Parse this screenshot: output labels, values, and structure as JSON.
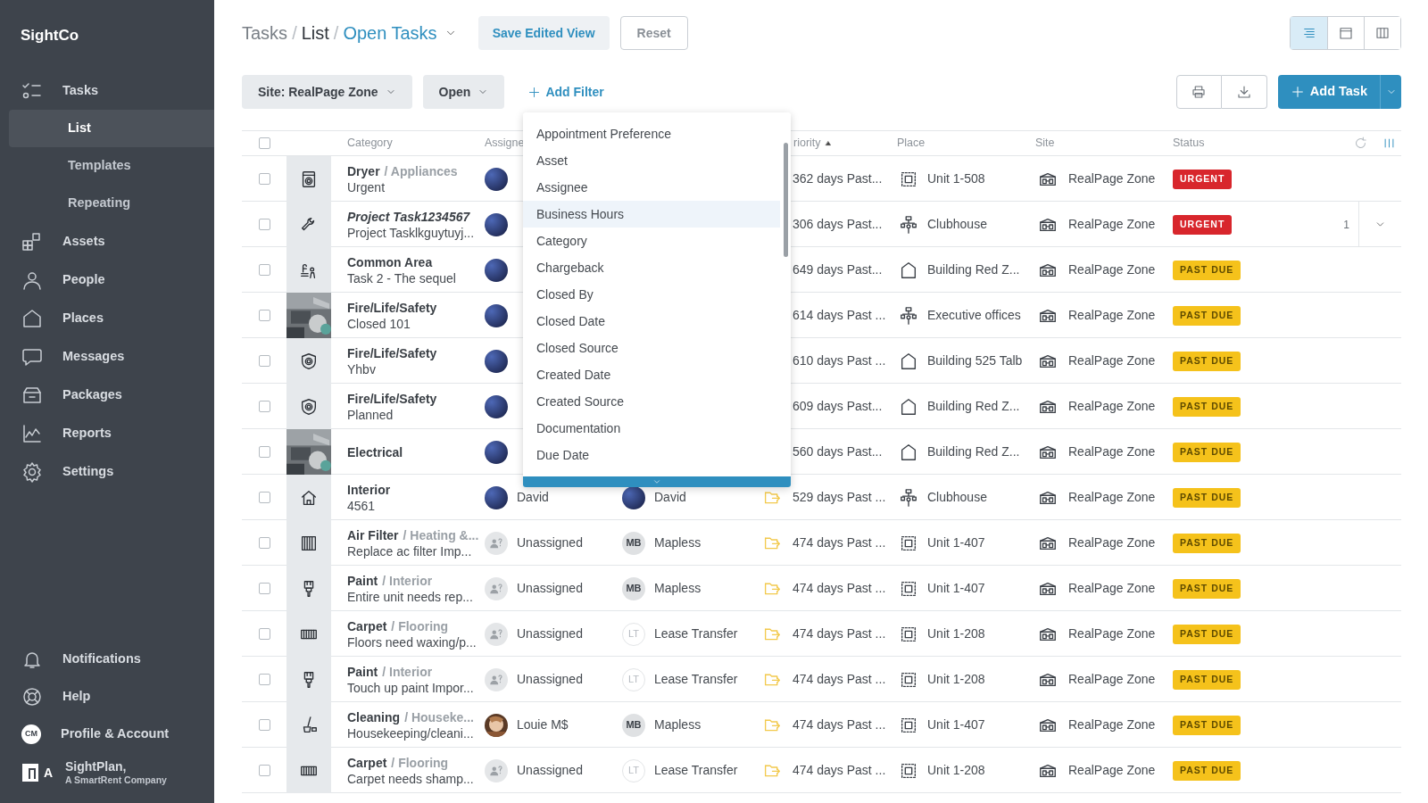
{
  "sidebar": {
    "logo": "SightCo",
    "nav": [
      {
        "kind": "tasks",
        "label": "Tasks",
        "selected": false,
        "children": [
          {
            "label": "List",
            "selected": true
          },
          {
            "label": "Templates",
            "selected": false
          },
          {
            "label": "Repeating",
            "selected": false
          }
        ]
      },
      {
        "kind": "assets",
        "label": "Assets",
        "selected": false
      },
      {
        "kind": "people",
        "label": "People",
        "selected": false
      },
      {
        "kind": "places",
        "label": "Places",
        "selected": false
      },
      {
        "kind": "messages",
        "label": "Messages",
        "selected": false
      },
      {
        "kind": "packages",
        "label": "Packages",
        "selected": false
      },
      {
        "kind": "reports",
        "label": "Reports",
        "selected": false
      },
      {
        "kind": "settings",
        "label": "Settings",
        "selected": false
      }
    ],
    "bottom": [
      {
        "kind": "bell",
        "label": "Notifications"
      },
      {
        "kind": "help",
        "label": "Help"
      },
      {
        "kind": "profile",
        "label": "Profile & Account",
        "initials": "CM"
      }
    ],
    "brand": {
      "mark": "A",
      "name": "SightPlan,",
      "tagline": "A SmartRent Company"
    }
  },
  "header": {
    "breadcrumb": [
      {
        "kind": "link",
        "label": "Tasks"
      },
      {
        "kind": "separator",
        "label": "/"
      },
      {
        "kind": "current",
        "label": "List"
      },
      {
        "kind": "separator",
        "label": "/"
      }
    ],
    "view": "Open Tasks",
    "buttons": [
      {
        "kind": "primary",
        "label": "Save Edited View"
      },
      {
        "kind": "outline",
        "label": "Reset"
      }
    ],
    "view_modes": [
      {
        "kind": "list",
        "selected": true
      },
      {
        "kind": "calendar",
        "selected": false
      },
      {
        "kind": "board",
        "selected": false
      }
    ]
  },
  "filters": [
    {
      "label": "Site: RealPage Zone"
    },
    {
      "label": "Open"
    }
  ],
  "add_filter": "Add Filter",
  "actions": [
    {
      "kind": "print"
    },
    {
      "kind": "download"
    }
  ],
  "add_task": "Add Task",
  "filter_menu": {
    "items": [
      {
        "label": "Appointment Preference",
        "selected": false
      },
      {
        "label": "Asset",
        "selected": false
      },
      {
        "label": "Assignee",
        "selected": false
      },
      {
        "label": "Business Hours",
        "selected": true
      },
      {
        "label": "Category",
        "selected": false
      },
      {
        "label": "Chargeback",
        "selected": false
      },
      {
        "label": "Closed By",
        "selected": false
      },
      {
        "label": "Closed Date",
        "selected": false
      },
      {
        "label": "Closed Source",
        "selected": false
      },
      {
        "label": "Created Date",
        "selected": false
      },
      {
        "label": "Created Source",
        "selected": false
      },
      {
        "label": "Documentation",
        "selected": false
      },
      {
        "label": "Due Date",
        "selected": false
      }
    ]
  },
  "table": {
    "select_all_checked": false,
    "columns": [
      {
        "label": "Category",
        "sorted": false
      },
      {
        "label": "Assigne",
        "sorted": false
      },
      {
        "label": "riority",
        "sorted": true
      },
      {
        "label": "Place",
        "sorted": false
      },
      {
        "label": "Site",
        "sorted": false
      },
      {
        "label": "Status",
        "sorted": false
      }
    ],
    "rows": [
      {
        "checked": false,
        "kind": "dryer",
        "category": "Dryer",
        "subcategory": "/ Appliances",
        "italic": false,
        "detail": "Urgent",
        "assignee": {
          "kind": "avatar"
        },
        "priority": "362 days Past...",
        "place": {
          "kind": "unit",
          "label": "Unit 1-508"
        },
        "site": "RealPage Zone",
        "status": {
          "kind": "urgent",
          "label": "URGENT"
        }
      },
      {
        "checked": false,
        "kind": "wrench",
        "category": "Project Task1234567",
        "italic": true,
        "detail": "Project Tasklkguytuyj...",
        "assignee": {
          "kind": "avatar"
        },
        "priority": "306 days Past...",
        "place": {
          "kind": "group",
          "label": "Clubhouse"
        },
        "site": "RealPage Zone",
        "status": {
          "kind": "urgent",
          "label": "URGENT"
        },
        "count": "1",
        "expanded": false
      },
      {
        "checked": false,
        "kind": "pool",
        "category": "Common Area",
        "italic": false,
        "detail": "Task 2 - The sequel",
        "assignee": {
          "kind": "avatar"
        },
        "priority": "649 days Past...",
        "place": {
          "kind": "building",
          "label": "Building Red Z..."
        },
        "site": "RealPage Zone",
        "status": {
          "kind": "past-due",
          "label": "PAST DUE"
        }
      },
      {
        "checked": false,
        "kind": "picture",
        "category": "Fire/Life/Safety",
        "italic": false,
        "detail": "Closed 101",
        "assignee": {
          "kind": "avatar"
        },
        "priority": "614 days Past ...",
        "place": {
          "kind": "group",
          "label": "Executive offices"
        },
        "site": "RealPage Zone",
        "status": {
          "kind": "past-due",
          "label": "PAST DUE"
        }
      },
      {
        "checked": false,
        "kind": "shield",
        "category": "Fire/Life/Safety",
        "italic": false,
        "detail": "Yhbv",
        "assignee": {
          "kind": "avatar"
        },
        "priority": "610 days Past ...",
        "place": {
          "kind": "building",
          "label": "Building 525 Talb"
        },
        "site": "RealPage Zone",
        "status": {
          "kind": "past-due",
          "label": "PAST DUE"
        }
      },
      {
        "checked": false,
        "kind": "shield",
        "category": "Fire/Life/Safety",
        "italic": false,
        "detail": "Planned",
        "assignee": {
          "kind": "avatar"
        },
        "priority": "609 days Past...",
        "place": {
          "kind": "building",
          "label": "Building Red Z..."
        },
        "site": "RealPage Zone",
        "status": {
          "kind": "past-due",
          "label": "PAST DUE"
        }
      },
      {
        "checked": false,
        "kind": "picture",
        "category": "Electrical",
        "italic": false,
        "assignee": {
          "kind": "avatar"
        },
        "priority": "560 days Past...",
        "place": {
          "kind": "building",
          "label": "Building Red Z..."
        },
        "site": "RealPage Zone",
        "status": {
          "kind": "past-due",
          "label": "PAST DUE"
        }
      },
      {
        "checked": false,
        "kind": "house",
        "category": "Interior",
        "italic": false,
        "detail": "4561",
        "assignee": {
          "kind": "avatar",
          "name": "David"
        },
        "owner": {
          "kind": "avatar",
          "name": "David"
        },
        "flag": true,
        "priority": "529 days Past ...",
        "place": {
          "kind": "group",
          "label": "Clubhouse"
        },
        "site": "RealPage Zone",
        "status": {
          "kind": "past-due",
          "label": "PAST DUE"
        }
      },
      {
        "checked": false,
        "kind": "filter",
        "category": "Air Filter",
        "subcategory": "/ Heating &...",
        "italic": false,
        "detail": "Replace ac filter Imp...",
        "assignee": {
          "kind": "unassigned",
          "name": "Unassigned"
        },
        "owner": {
          "kind": "initials",
          "initials": "MB",
          "name": "Mapless"
        },
        "flag": true,
        "priority": "474 days Past ...",
        "place": {
          "kind": "unit",
          "label": "Unit 1-407"
        },
        "site": "RealPage Zone",
        "status": {
          "kind": "past-due",
          "label": "PAST DUE"
        }
      },
      {
        "checked": false,
        "kind": "brush",
        "category": "Paint",
        "subcategory": "/ Interior",
        "italic": false,
        "detail": "Entire unit needs rep...",
        "assignee": {
          "kind": "unassigned",
          "name": "Unassigned"
        },
        "owner": {
          "kind": "initials",
          "initials": "MB",
          "name": "Mapless"
        },
        "flag": true,
        "priority": "474 days Past ...",
        "place": {
          "kind": "unit",
          "label": "Unit 1-407"
        },
        "site": "RealPage Zone",
        "status": {
          "kind": "past-due",
          "label": "PAST DUE"
        }
      },
      {
        "checked": false,
        "kind": "carpet",
        "category": "Carpet",
        "subcategory": "/ Flooring",
        "italic": false,
        "detail": "Floors need waxing/p...",
        "assignee": {
          "kind": "unassigned",
          "name": "Unassigned"
        },
        "owner": {
          "kind": "outline",
          "initials": "LT",
          "name": "Lease Transfer"
        },
        "flag": true,
        "priority": "474 days Past ...",
        "place": {
          "kind": "unit",
          "label": "Unit 1-208"
        },
        "site": "RealPage Zone",
        "status": {
          "kind": "past-due",
          "label": "PAST DUE"
        }
      },
      {
        "checked": false,
        "kind": "brush",
        "category": "Paint",
        "subcategory": "/ Interior",
        "italic": false,
        "detail": "Touch up paint Impor...",
        "assignee": {
          "kind": "unassigned",
          "name": "Unassigned"
        },
        "owner": {
          "kind": "outline",
          "initials": "LT",
          "name": "Lease Transfer"
        },
        "flag": true,
        "priority": "474 days Past ...",
        "place": {
          "kind": "unit",
          "label": "Unit 1-208"
        },
        "site": "RealPage Zone",
        "status": {
          "kind": "past-due",
          "label": "PAST DUE"
        }
      },
      {
        "checked": false,
        "kind": "broom",
        "category": "Cleaning",
        "subcategory": "/ Houseke...",
        "italic": false,
        "detail": "Housekeeping/cleani...",
        "assignee": {
          "name": "Louie M$"
        },
        "owner": {
          "kind": "initials",
          "initials": "MB",
          "name": "Mapless"
        },
        "flag": true,
        "priority": "474 days Past ...",
        "place": {
          "kind": "unit",
          "label": "Unit 1-407"
        },
        "site": "RealPage Zone",
        "status": {
          "kind": "past-due",
          "label": "PAST DUE"
        }
      },
      {
        "checked": false,
        "kind": "carpet",
        "category": "Carpet",
        "subcategory": "/ Flooring",
        "italic": false,
        "detail": "Carpet needs shamp...",
        "assignee": {
          "kind": "unassigned",
          "name": "Unassigned"
        },
        "owner": {
          "kind": "outline",
          "initials": "LT",
          "name": "Lease Transfer"
        },
        "flag": true,
        "priority": "474 days Past ...",
        "place": {
          "kind": "unit",
          "label": "Unit 1-208"
        },
        "site": "RealPage Zone",
        "status": {
          "kind": "past-due",
          "label": "PAST DUE"
        }
      }
    ]
  }
}
